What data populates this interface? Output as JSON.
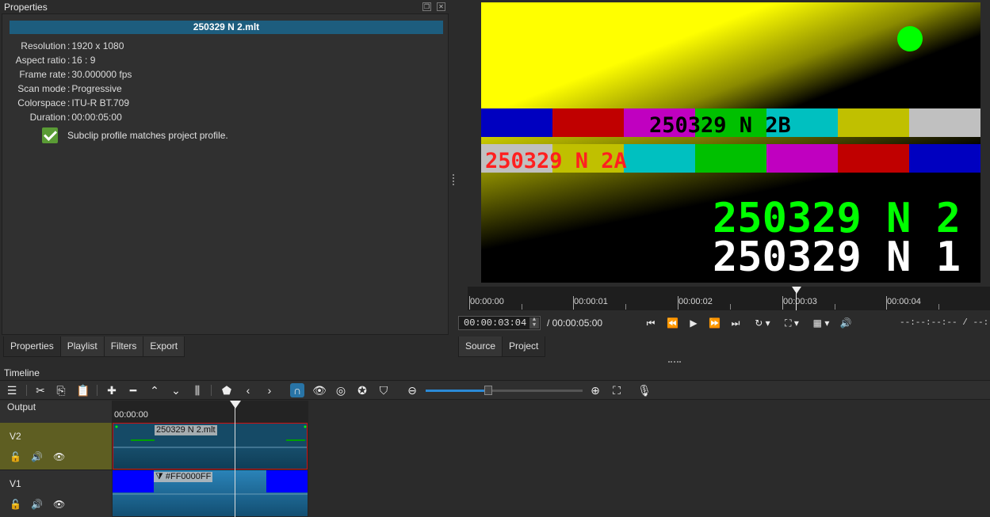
{
  "properties": {
    "title": "Properties",
    "clip_name": "250329 N 2.mlt",
    "rows": [
      {
        "label": "Resolution",
        "value": "1920 x 1080"
      },
      {
        "label": "Aspect ratio",
        "value": "16 : 9"
      },
      {
        "label": "Frame rate",
        "value": "30.000000 fps"
      },
      {
        "label": "Scan mode",
        "value": "Progressive"
      },
      {
        "label": "Colorspace",
        "value": "ITU-R BT.709"
      },
      {
        "label": "Duration",
        "value": "00:00:05:00"
      }
    ],
    "profile_match": "Subclip profile matches project profile."
  },
  "left_tabs": [
    "Properties",
    "Playlist",
    "Filters",
    "Export"
  ],
  "preview": {
    "text_b": "250329 N 2B",
    "text_a": "250329 N 2A",
    "line1": "250329 N 2",
    "line2": "250329 N 1",
    "colors": {
      "yellow": "#ffff00",
      "green_dot": "#00ff00",
      "red_text": "#ff2020",
      "green_text": "#00ff00"
    }
  },
  "transport": {
    "ruler_labels": [
      "00:00:00",
      "00:00:01",
      "00:00:02",
      "00:00:03",
      "00:00:04"
    ],
    "timecode": "00:00:03:04",
    "duration": "/ 00:00:05:00",
    "in_point": "--:--:--:--",
    "out_point": "--:--:--:--",
    "icons": [
      "skip-start-icon",
      "rewind-icon",
      "play-icon",
      "fast-forward-icon",
      "skip-end-icon",
      "loop-icon",
      "zoom-icon",
      "grid-icon",
      "volume-icon"
    ]
  },
  "source_tabs": [
    "Source",
    "Project"
  ],
  "timeline": {
    "title": "Timeline",
    "output_label": "Output",
    "ruler_start": "00:00:00",
    "tracks": [
      {
        "name": "V2",
        "clip": "250329 N 2.mlt",
        "highlight": "#5e5e22"
      },
      {
        "name": "V1",
        "clip": "#FF0000FF",
        "highlight": "#303030"
      }
    ]
  }
}
